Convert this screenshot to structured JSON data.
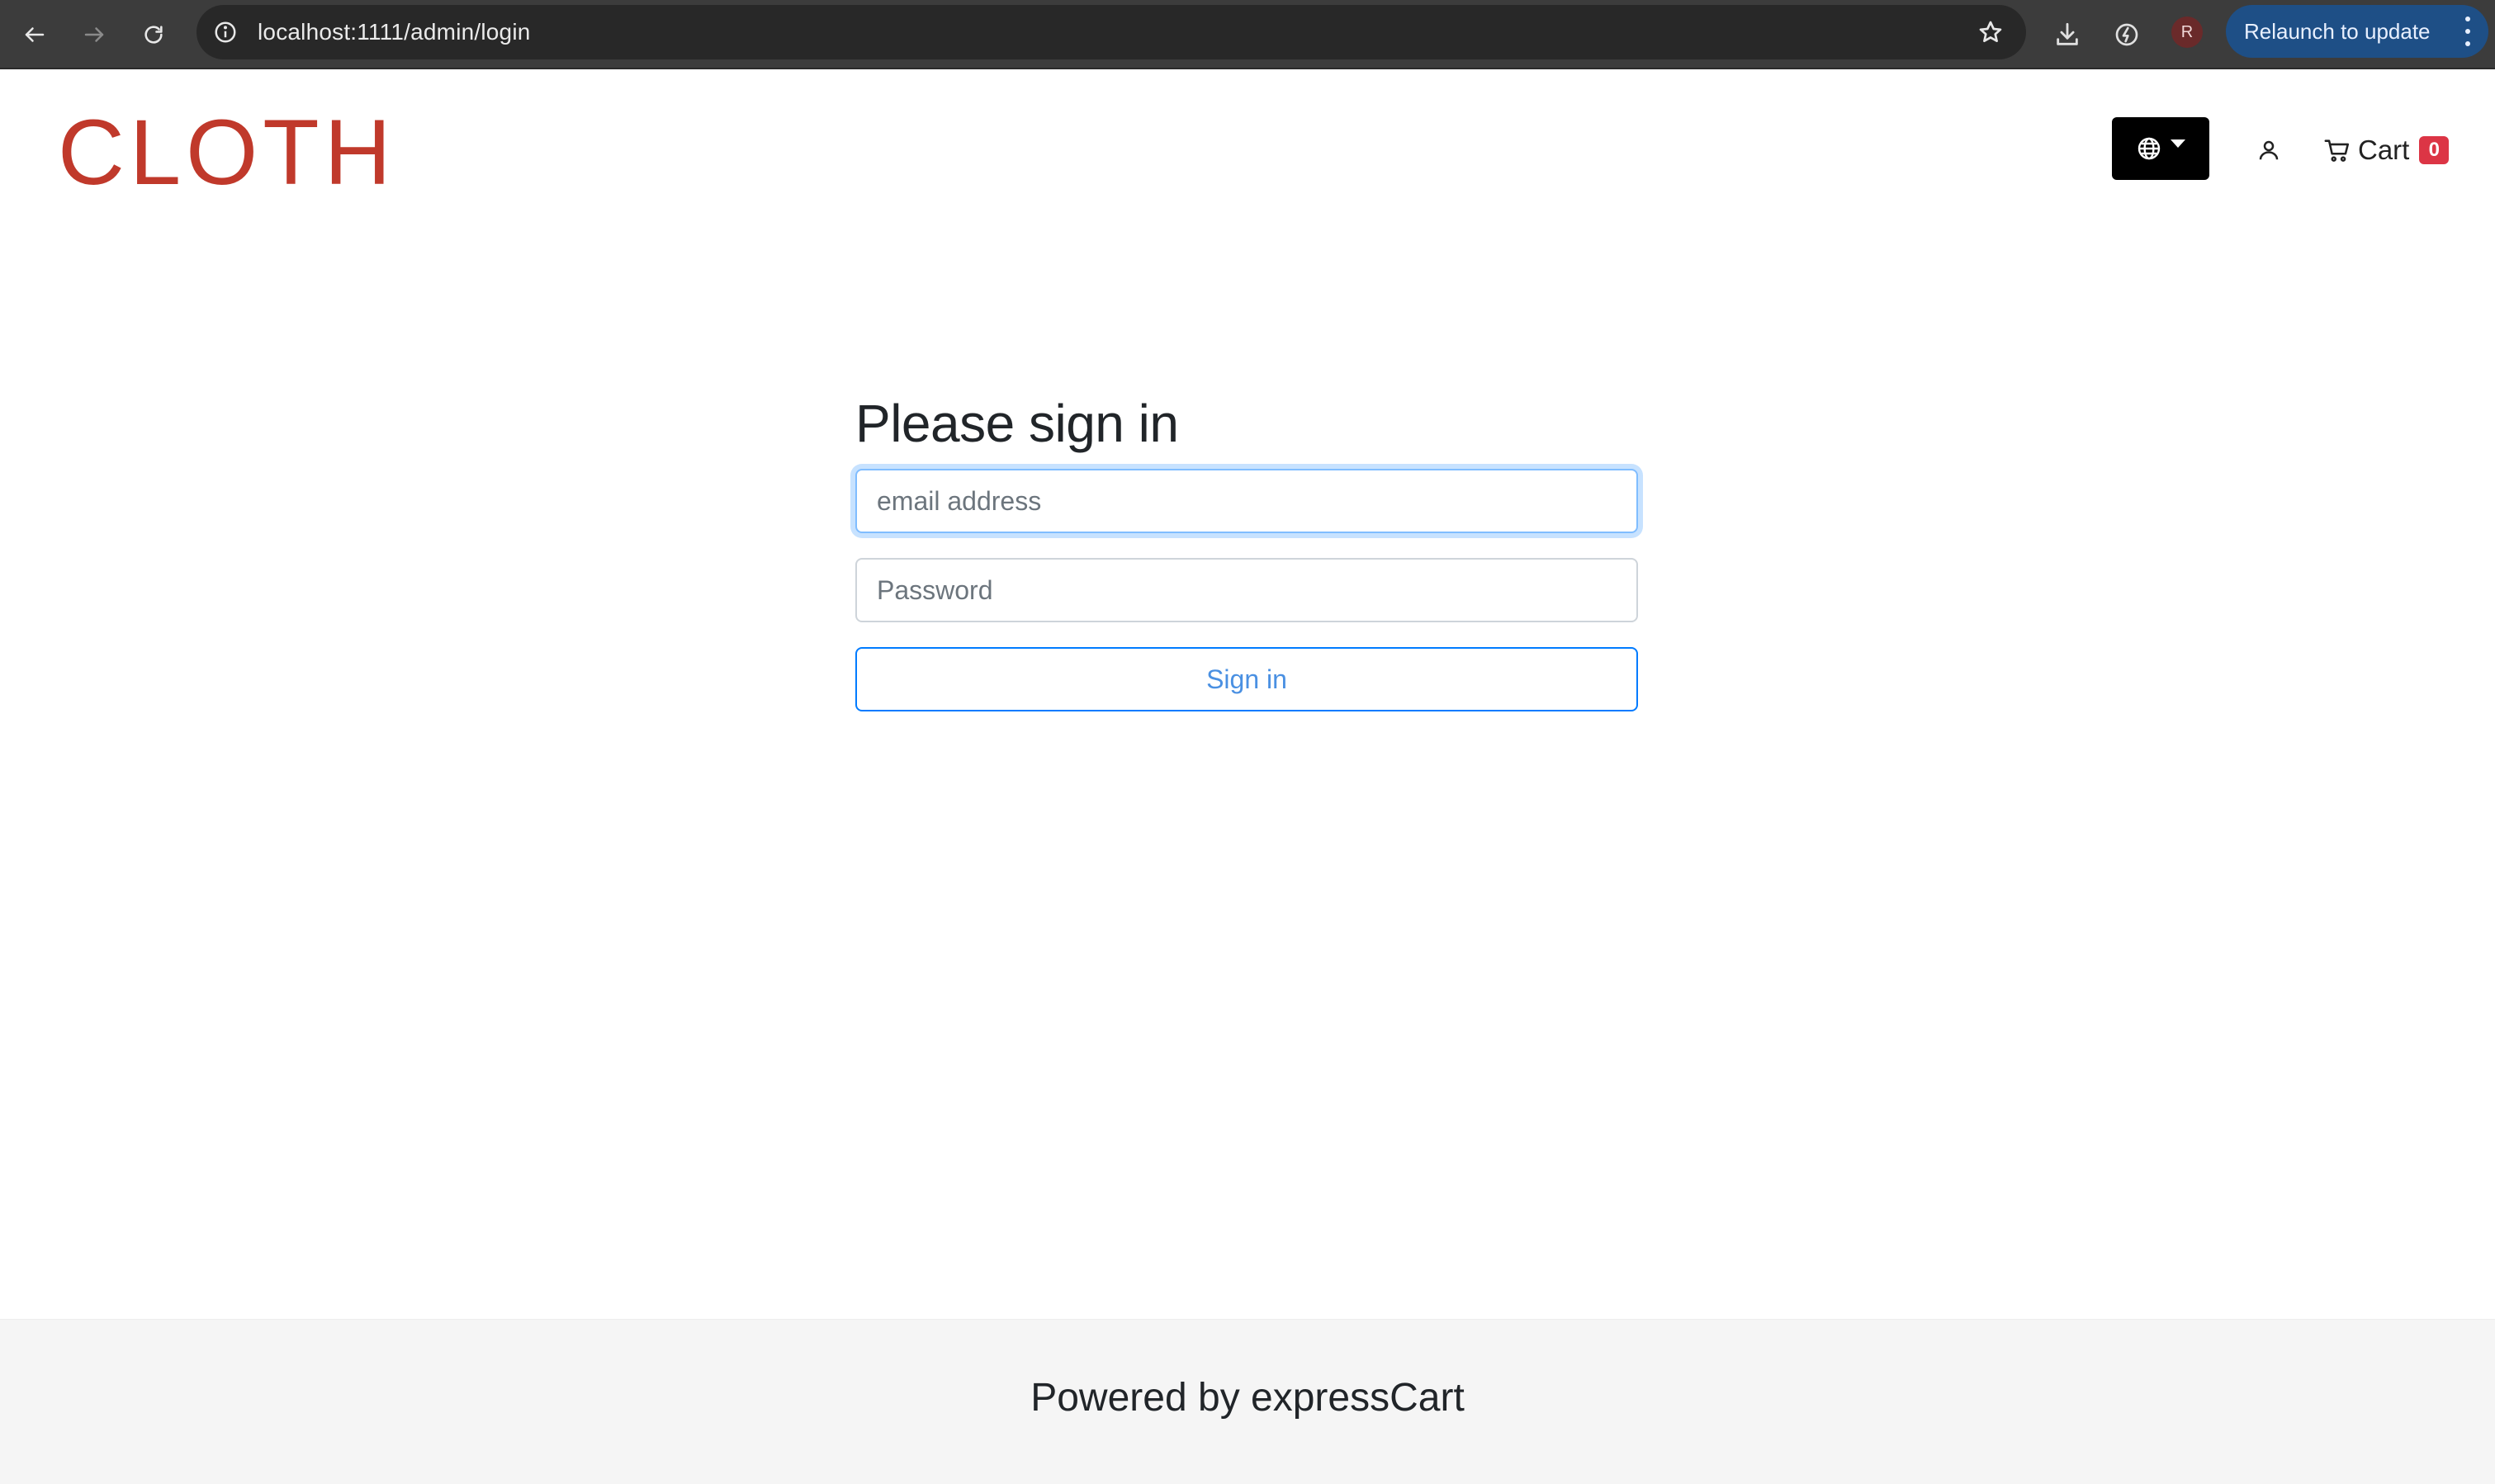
{
  "browser": {
    "url": "localhost:1111/admin/login",
    "relaunch_label": "Relaunch to update",
    "profile_initial": "R",
    "icons": [
      "back-arrow-icon",
      "forward-arrow-icon",
      "reload-icon",
      "site-info-icon",
      "bookmark-star-icon",
      "download-icon",
      "performance-icon",
      "more-vert-icon"
    ]
  },
  "header": {
    "logo": "CLOTH",
    "logo_color": "#c0392b",
    "language_icon": "globe-icon",
    "user_icon": "user-icon",
    "cart_label": "Cart",
    "cart_count": "0",
    "cart_icon": "cart-icon"
  },
  "login": {
    "title": "Please sign in",
    "email_placeholder": "email address",
    "password_placeholder": "Password",
    "submit_label": "Sign in"
  },
  "footer": {
    "text": "Powered by expressCart"
  }
}
